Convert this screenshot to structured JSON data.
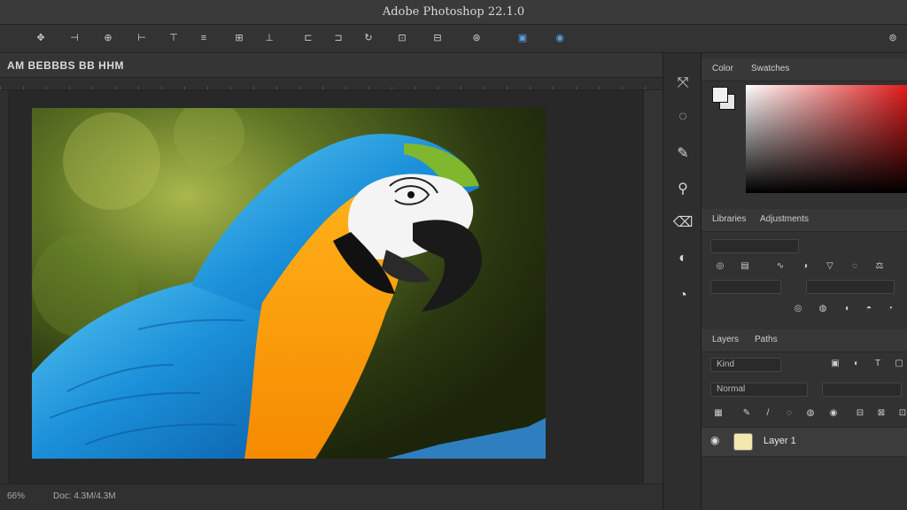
{
  "app": {
    "title": "Adobe Photoshop 22.1.0"
  },
  "options_bar": {
    "icons": [
      "move-icon",
      "align-left-icon",
      "align-center-icon",
      "align-right-icon",
      "align-top-icon",
      "distribute-icon",
      "align-middle-icon",
      "align-bottom-icon",
      "distribute-h-icon",
      "distribute-v-icon",
      "rotate-icon",
      "transform-icon",
      "arrange-icon",
      "mode-3d-icon",
      "auto-select-icon",
      "share-icon"
    ]
  },
  "document": {
    "tab_label": "AM BEBBBS BB HHM"
  },
  "status": {
    "zoom": "66%",
    "info": "Doc: 4.3M/4.3M"
  },
  "tools": {
    "items": [
      "move-tool",
      "lasso-tool",
      "brush-tool",
      "stamp-tool",
      "eraser-tool",
      "gradient-tool",
      "dodge-tool"
    ]
  },
  "panels": {
    "color": {
      "tabs": [
        "Color",
        "Swatches"
      ],
      "fg_color": "#f0f0f0",
      "bg_color": "#e6e6e6",
      "accent": "#e21b1b"
    },
    "properties": {
      "tabs": [
        "Libraries",
        "Adjustments"
      ]
    },
    "layers": {
      "tabs": [
        "Layers",
        "Paths"
      ],
      "filter_label": "Kind",
      "blend_label": "Normal",
      "layer_name": "Layer 1"
    }
  }
}
